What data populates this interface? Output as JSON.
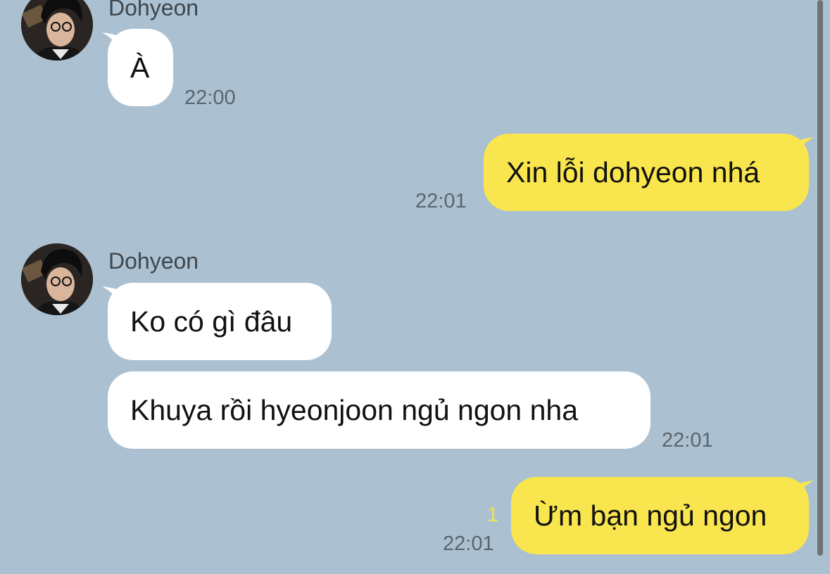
{
  "messages": [
    {
      "sender": "Dohyeon",
      "text": "À",
      "time": "22:00"
    },
    {
      "text": "Xin lỗi dohyeon nhá",
      "time": "22:01"
    },
    {
      "sender": "Dohyeon",
      "text": "Ko có gì đâu"
    },
    {
      "text": "Khuya rồi hyeonjoon ngủ ngon nha",
      "time": "22:01"
    },
    {
      "text": "Ừm bạn ngủ ngon",
      "time": "22:01",
      "unread": "1"
    }
  ],
  "colors": {
    "background": "#abc1d1",
    "incoming_bubble": "#ffffff",
    "outgoing_bubble": "#f9e54e",
    "unread_count": "#f4e34a"
  },
  "icons": {
    "avatar": "profile-photo"
  }
}
